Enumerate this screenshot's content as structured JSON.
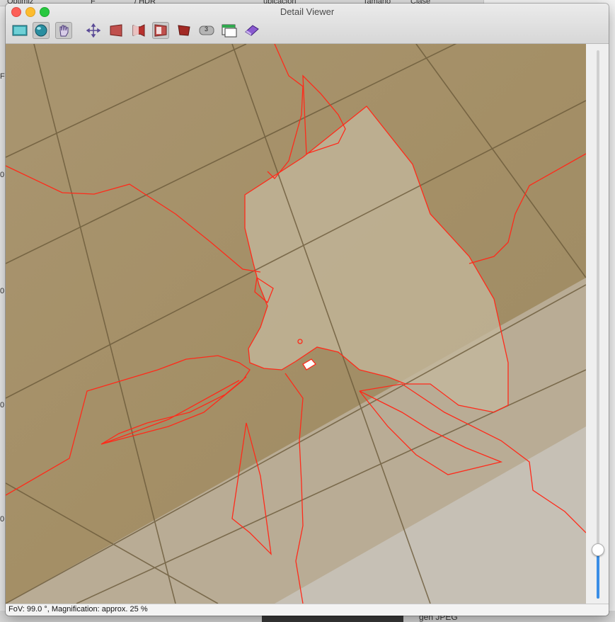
{
  "window": {
    "title": "Detail Viewer"
  },
  "background": {
    "col1": "Optimiz",
    "col2": "F",
    "col3": "/ HDR",
    "col4": "ubicacion",
    "col5": "Tamaño",
    "col6": "Clase",
    "bottom_right_label": "gen JPEG",
    "left_marks": [
      "F",
      "0",
      "0",
      "0",
      "0"
    ]
  },
  "toolbar": {
    "tools": [
      {
        "icon": "rectilinear-view-icon",
        "active": false
      },
      {
        "icon": "sphere-view-icon",
        "active": true
      },
      {
        "icon": "hand-drag-icon",
        "active": true
      },
      {
        "icon": "move-arrows-icon",
        "active": false
      },
      {
        "icon": "warp-left-icon",
        "active": false
      },
      {
        "icon": "warp-center-icon",
        "active": false
      },
      {
        "icon": "warp-selected-icon",
        "active": true
      },
      {
        "icon": "warp-right-icon",
        "active": false
      },
      {
        "icon": "number-badge-icon",
        "label": "3",
        "active": false
      },
      {
        "icon": "window-split-icon",
        "active": false
      },
      {
        "icon": "eraser-icon",
        "active": false
      }
    ]
  },
  "slider": {
    "value": 0.09
  },
  "status": {
    "text": "FoV: 99.0 °, Magnification: approx. 25 %"
  },
  "colors": {
    "seam_line": "#ff2a1a",
    "tile_base": "#a48f66",
    "slider_accent": "#3a8ee6"
  }
}
